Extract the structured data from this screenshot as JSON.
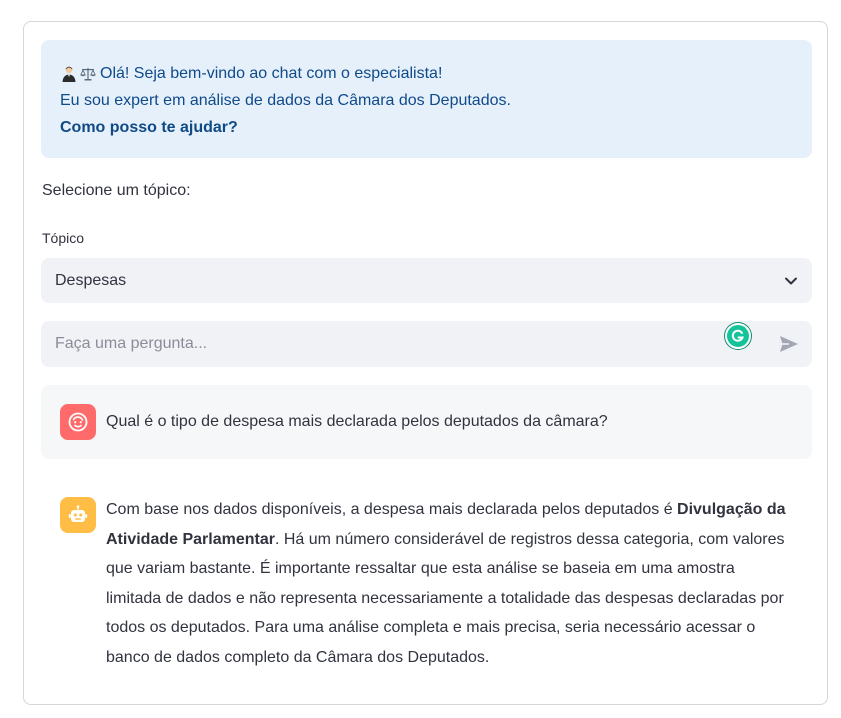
{
  "info": {
    "greeting": "Olá! Seja bem-vindo ao chat com o especialista!",
    "intro": "Eu sou expert em análise de dados da Câmara dos Deputados.",
    "question": "Como posso te ajudar?",
    "emoji_icons": [
      "man-judge-icon",
      "balance-scale-icon"
    ]
  },
  "select_prompt": "Selecione um tópico:",
  "topic": {
    "label": "Tópico",
    "selected": "Despesas"
  },
  "chat_input": {
    "placeholder": "Faça uma pergunta..."
  },
  "messages": {
    "user": {
      "text": "Qual é o tipo de despesa mais declarada pelos deputados da câmara?"
    },
    "assistant": {
      "part1": "Com base nos dados disponíveis, a despesa mais declarada pelos deputados é ",
      "bold": "Divulgação da Atividade Parlamentar",
      "part2": ". Há um número considerável de registros dessa categoria, com valores que variam bastante. É importante ressaltar que esta análise se baseia em uma amostra limitada de dados e não representa necessariamente a totalidade das despesas declaradas por todos os deputados. Para uma análise completa e mais precisa, seria necessário acessar o banco de dados completo da Câmara dos Deputados."
    }
  },
  "colors": {
    "info_bg": "#e6f0fb",
    "info_text": "#0f4a8a",
    "user_avatar": "#ff6b6b",
    "bot_avatar": "#ffbd45",
    "input_bg": "#f0f2f6"
  }
}
